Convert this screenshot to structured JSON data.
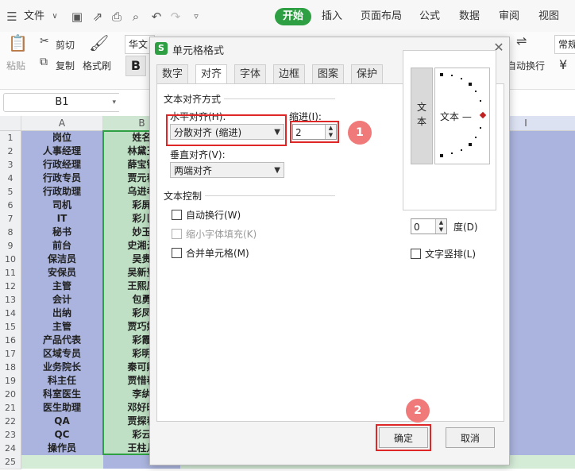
{
  "menubar": {
    "file_label": "文件",
    "tabs": [
      "开始",
      "插入",
      "页面布局",
      "公式",
      "数据",
      "审阅",
      "视图"
    ]
  },
  "ribbon": {
    "paste": "粘贴",
    "cut": "剪切",
    "copy": "复制",
    "format_painter": "格式刷",
    "font_name": "华文",
    "bold": "B",
    "auto_wrap": "自动换行",
    "normal": "常规",
    "currency": "¥"
  },
  "formula_bar": {
    "cell_ref": "B1"
  },
  "sheet": {
    "columns": [
      "A",
      "B",
      "I"
    ],
    "rows": [
      "1",
      "2",
      "3",
      "4",
      "5",
      "6",
      "7",
      "8",
      "9",
      "10",
      "11",
      "12",
      "13",
      "14",
      "15",
      "16",
      "17",
      "18",
      "19",
      "20",
      "21",
      "22",
      "23",
      "24",
      "25"
    ],
    "col_a": [
      "岗位",
      "人事经理",
      "行政经理",
      "行政专员",
      "行政助理",
      "司机",
      "IT",
      "秘书",
      "前台",
      "保洁员",
      "安保员",
      "主管",
      "会计",
      "出纳",
      "主管",
      "产品代表",
      "区域专员",
      "业务院长",
      "科主任",
      "科室医生",
      "医生助理",
      "QA",
      "QC",
      "操作员"
    ],
    "col_b": [
      "姓名",
      "林黛玉",
      "薛宝钗",
      "贾元春",
      "乌进孝",
      "彩屏",
      "彩儿",
      "妙玉",
      "史湘云",
      "吴贵",
      "吴新登",
      "王熙凤",
      "包勇",
      "彩凤",
      "贾巧姐",
      "彩霞",
      "彩明",
      "秦可卿",
      "贾惜春",
      "李纨",
      "邓好时",
      "贾探春",
      "彩云",
      "王柱儿"
    ]
  },
  "dialog": {
    "title": "单元格格式",
    "tabs": [
      "数字",
      "对齐",
      "字体",
      "边框",
      "图案",
      "保护"
    ],
    "text_alignment_section": "文本对齐方式",
    "horizontal_label": "水平对齐(H):",
    "horizontal_value": "分散对齐 (缩进)",
    "indent_label": "缩进(I):",
    "indent_value": "2",
    "vertical_label": "垂直对齐(V):",
    "vertical_value": "两端对齐",
    "text_control_section": "文本控制",
    "wrap_text": "自动换行(W)",
    "shrink_to_fit": "缩小字体填充(K)",
    "merge_cells": "合并单元格(M)",
    "orientation_section": "方向",
    "vertical_text": "文本",
    "dial_text": "文本 —",
    "degree_value": "0",
    "degree_label": "度(D)",
    "vertical_stack": "文字竖排(L)",
    "ok_button": "确定",
    "cancel_button": "取消",
    "badge_1": "1",
    "badge_2": "2"
  },
  "colors": {
    "accent": "#2ea043",
    "highlight": "#e02727",
    "badge": "#f07a7a",
    "col_a_fill": "#aab4de",
    "col_b_fill": "#bfe0c4"
  }
}
